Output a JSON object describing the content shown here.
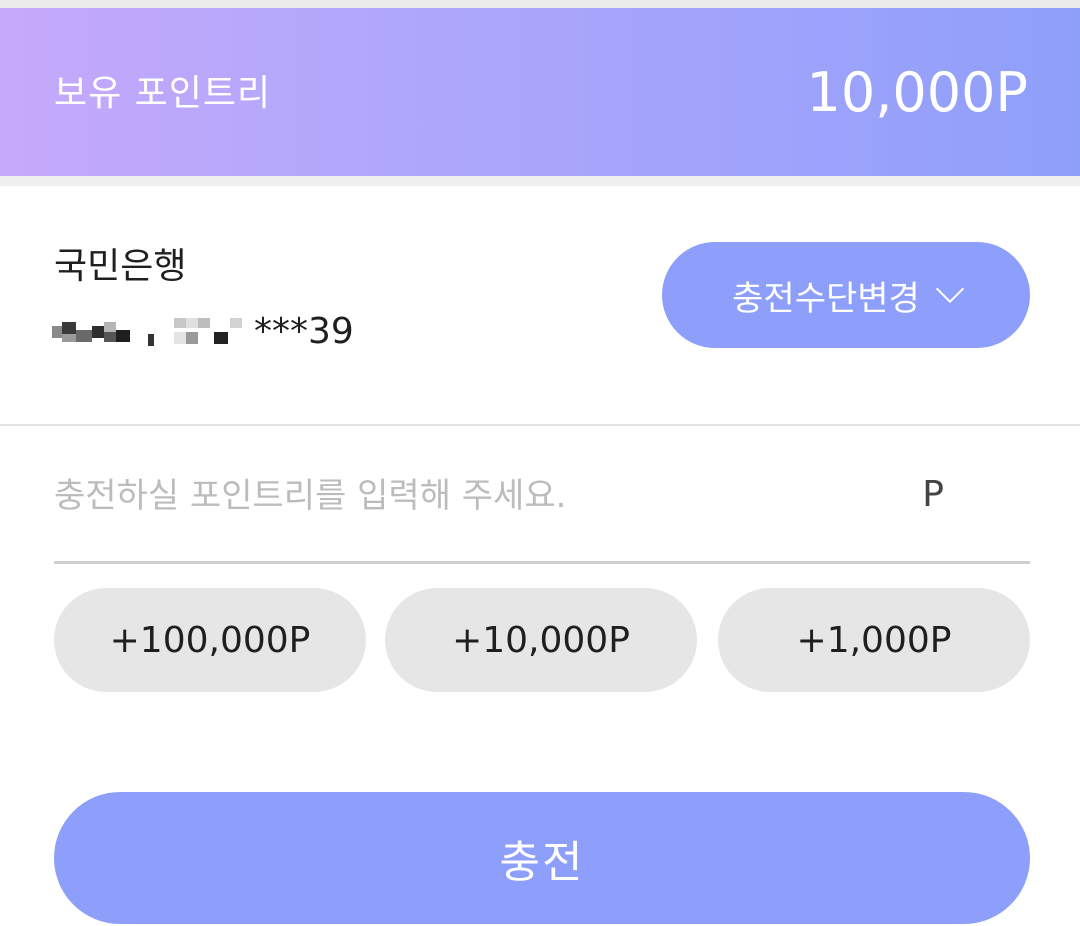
{
  "header": {
    "label": "보유 포인트리",
    "amount": "10,000P"
  },
  "payment": {
    "bank_name": "국민은행",
    "account_masked_suffix": "***39",
    "change_method_label": "충전수단변경"
  },
  "charge_input": {
    "placeholder": "충전하실 포인트리를 입력해 주세요.",
    "value": "",
    "unit": "P"
  },
  "quick_amounts": [
    {
      "label": "+100,000P"
    },
    {
      "label": "+10,000P"
    },
    {
      "label": "+1,000P"
    }
  ],
  "submit": {
    "label": "충전"
  },
  "colors": {
    "accent": "#8e9ffb",
    "gradient_start": "#c6a9fb",
    "gradient_end": "#8e9ffa",
    "quick_button_bg": "#e6e6e6"
  }
}
